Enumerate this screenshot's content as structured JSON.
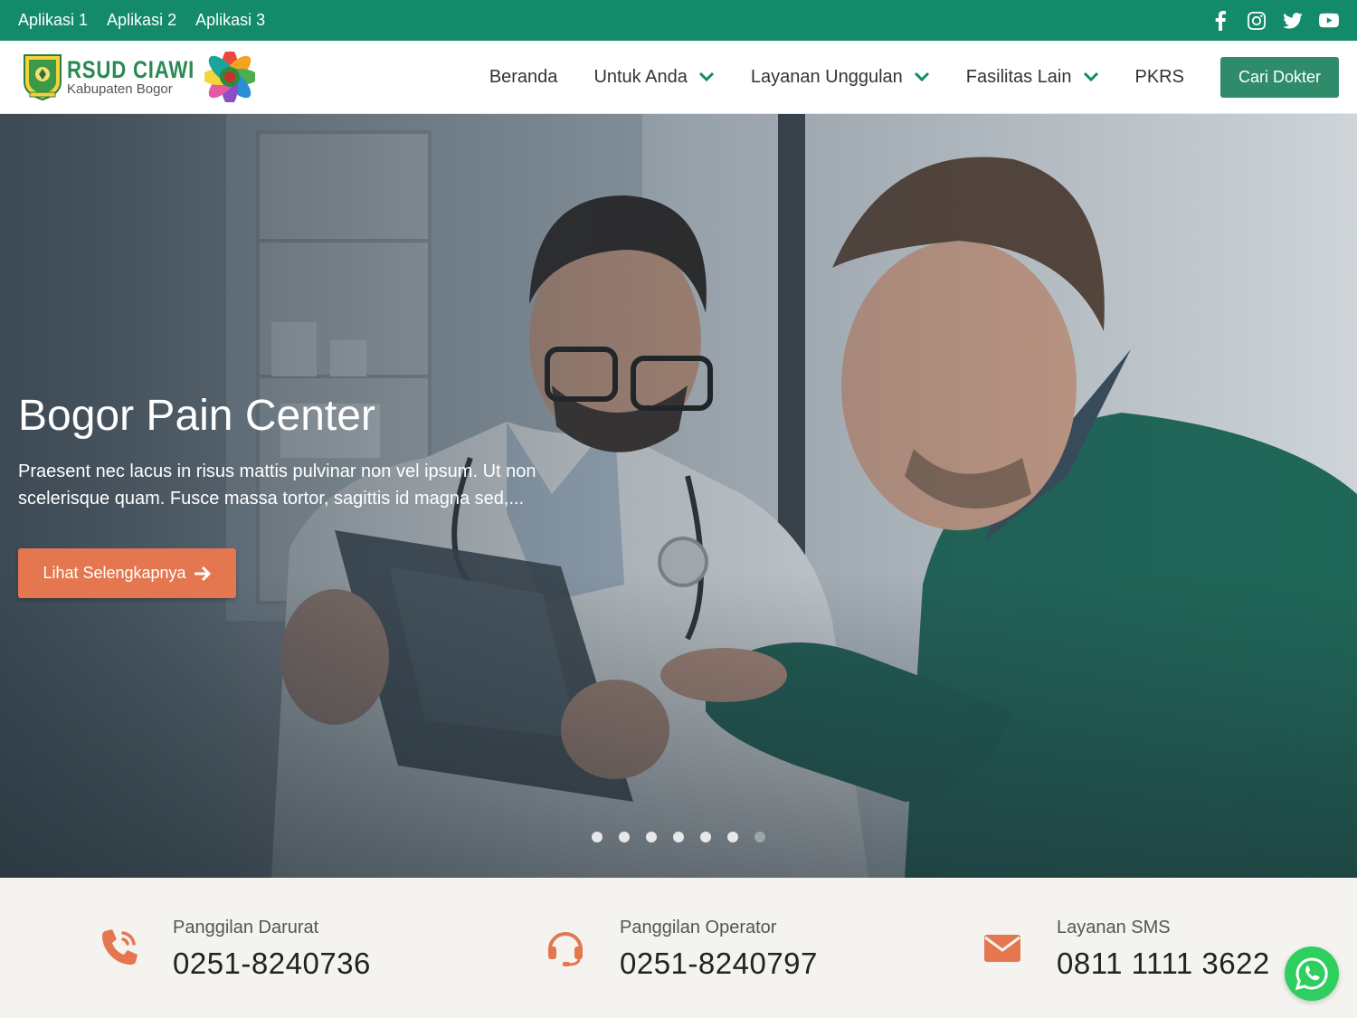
{
  "topbar": {
    "links": [
      "Aplikasi 1",
      "Aplikasi 2",
      "Aplikasi 3"
    ],
    "social_icons": [
      "facebook-icon",
      "instagram-icon",
      "twitter-icon",
      "youtube-icon"
    ],
    "bg_color": "#138a6a"
  },
  "header": {
    "logo_title": "RSUD CIAWI",
    "logo_sub": "Kabupaten Bogor",
    "nav": [
      {
        "label": "Beranda",
        "has_dropdown": false
      },
      {
        "label": "Untuk Anda",
        "has_dropdown": true
      },
      {
        "label": "Layanan Unggulan",
        "has_dropdown": true
      },
      {
        "label": "Fasilitas Lain",
        "has_dropdown": true
      },
      {
        "label": "PKRS",
        "has_dropdown": false
      }
    ],
    "cta_label": "Cari Dokter",
    "cta_color": "#2f8c6a"
  },
  "hero": {
    "title": "Bogor Pain Center",
    "description": "Praesent nec lacus in risus mattis pulvinar non vel ipsum. Ut non scelerisque quam. Fusce massa tortor, sagittis id magna sed,...",
    "button_label": "Lihat Selengkapnya",
    "button_color": "#e4774f",
    "slide_count": 7,
    "active_slide": 7
  },
  "contacts": [
    {
      "icon": "phone-volume-icon",
      "label": "Panggilan Darurat",
      "value": "0251-8240736"
    },
    {
      "icon": "headset-icon",
      "label": "Panggilan Operator",
      "value": "0251-8240797"
    },
    {
      "icon": "envelope-icon",
      "label": "Layanan SMS",
      "value": "0811 1111 3622"
    }
  ],
  "accent_color": "#e4774f",
  "whatsapp_icon": "whatsapp-icon"
}
